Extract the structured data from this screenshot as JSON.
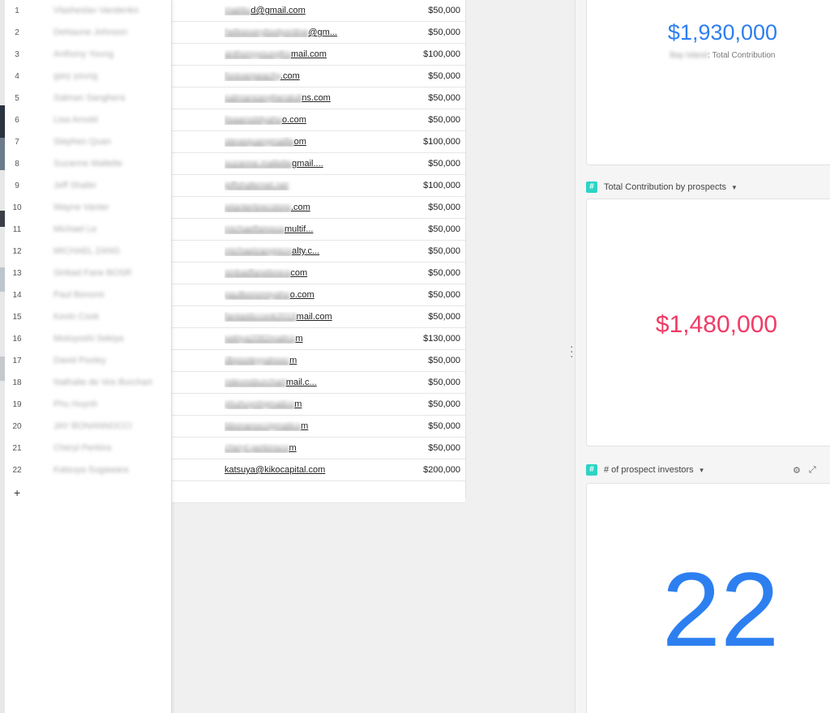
{
  "grid": {
    "add_row_label": "+",
    "rows": [
      {
        "num": "1",
        "name": "Vlasheslav Vandenko",
        "email_blur": "mail4u",
        "email_vis": "d@gmail.com",
        "amount": "$50,000"
      },
      {
        "num": "2",
        "name": "DeNaune Johnson",
        "email_blur": "helloeverybodyonline",
        "email_vis": "@gm...",
        "amount": "$50,000"
      },
      {
        "num": "3",
        "name": "Anthony Young",
        "email_blur": "anthonyyoungfro",
        "email_vis": "mail.com",
        "amount": "$100,000"
      },
      {
        "num": "4",
        "name": "gary young",
        "email_blur": "foreverpeachy",
        "email_vis": ".com",
        "amount": "$50,000"
      },
      {
        "num": "5",
        "name": "Salman Sanghera",
        "email_blur": "salmansangheraluti",
        "email_vis": "ns.com",
        "amount": "$50,000"
      },
      {
        "num": "6",
        "name": "Lisa Arnold",
        "email_blur": "lisaarnoldyaho",
        "email_vis": "o.com",
        "amount": "$50,000"
      },
      {
        "num": "7",
        "name": "Stephen Quan",
        "email_blur": "stevequangmaille",
        "email_vis": "om",
        "amount": "$100,000"
      },
      {
        "num": "8",
        "name": "Suzanne Mallette",
        "email_blur": "suzanne.mallette",
        "email_vis": "gmail....",
        "amount": "$50,000"
      },
      {
        "num": "9",
        "name": "Jeff Shafer",
        "email_blur": "jeffshafernet.net",
        "email_vis": "",
        "amount": "$100,000"
      },
      {
        "num": "10",
        "name": "Wayne Vanter",
        "email_blur": "wtanterbrecstore",
        "email_vis": ".com",
        "amount": "$50,000"
      },
      {
        "num": "11",
        "name": "Michael Le",
        "email_blur": "michaelfamous",
        "email_vis": "multif...",
        "amount": "$50,000"
      },
      {
        "num": "12",
        "name": "MICHAEL ZANG",
        "email_blur": "michaelzangreco",
        "email_vis": "alty.c...",
        "amount": "$50,000"
      },
      {
        "num": "13",
        "name": "Sinbad Fane BOSR",
        "email_blur": "sinbadfanebosra",
        "email_vis": "com",
        "amount": "$50,000"
      },
      {
        "num": "14",
        "name": "Paul Bonomi",
        "email_blur": "paulbonomiyaho",
        "email_vis": "o.com",
        "amount": "$50,000"
      },
      {
        "num": "15",
        "name": "Kevin Cook",
        "email_blur": "fantasticcook2019",
        "email_vis": "mail.com",
        "amount": "$50,000"
      },
      {
        "num": "16",
        "name": "Motoyoshi Sekiya",
        "email_blur": "sekiya2082mailco",
        "email_vis": "m",
        "amount": "$130,000"
      },
      {
        "num": "17",
        "name": "David Pooley",
        "email_blur": "dbpooleyyahooc",
        "email_vis": "m",
        "amount": "$50,000"
      },
      {
        "num": "18",
        "name": "Nathalie de Vos Burchart",
        "email_blur": "ndevosburchart",
        "email_vis": "mail.c...",
        "amount": "$50,000"
      },
      {
        "num": "19",
        "name": "Phu Huynh",
        "email_blur": "phuhuynhgmailco",
        "email_vis": "m",
        "amount": "$50,000"
      },
      {
        "num": "20",
        "name": "JAY BONANNOCCI",
        "email_blur": "bbonanoccigmailco",
        "email_vis": "m",
        "amount": "$50,000"
      },
      {
        "num": "21",
        "name": "Cheryl Perkins",
        "email_blur": "cheryl.perkinsco",
        "email_vis": "m",
        "amount": "$50,000"
      },
      {
        "num": "22",
        "name": "Katsuya Sugawara",
        "email_blur": "",
        "email_vis": "katsuya@kikocapital.com",
        "amount": "$200,000"
      }
    ]
  },
  "dashboard": {
    "card1": {
      "value": "$1,930,000",
      "sub_blur": "Bay Island",
      "sub_vis": ": Total Contribution"
    },
    "card2": {
      "title": "Total Contribution by prospects",
      "value": "$1,480,000"
    },
    "card3": {
      "title": "# of prospect investors",
      "value": "22"
    },
    "hash_glyph": "#",
    "caret_glyph": "▼",
    "tool_icons": [
      "gear-icon",
      "expand-icon"
    ],
    "colors": {
      "blue": "#2d7ff0",
      "pink": "#f03b65",
      "teal": "#2dd4c4"
    }
  }
}
